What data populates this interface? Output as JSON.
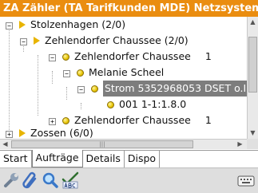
{
  "title": "ZA Zähler (TA Tarifkunden MDE) Netzsystem",
  "tree": {
    "items": [
      {
        "label": "Stolzenhagen (2/0)",
        "icon": "folder-triangle-icon",
        "expander": "−"
      },
      {
        "label": "Zehlendorfer Chaussee (2/0)",
        "icon": "folder-triangle-icon",
        "expander": "−"
      },
      {
        "label": "Zehlendorfer Chaussee",
        "suffix": "1",
        "icon": "address-dot-icon",
        "expander": "−"
      },
      {
        "label": "Melanie Scheel",
        "icon": "customer-dot-icon",
        "expander": "−"
      },
      {
        "label": "Strom 5352968053 DSET o.I",
        "icon": "meter-dot-icon",
        "expander": "−",
        "selected": true
      },
      {
        "label": "001 1-1:1.8.0",
        "icon": "register-dot-icon"
      },
      {
        "label": "Zehlendorfer Chaussee",
        "suffix": "1",
        "icon": "address-dot-icon",
        "expander": "+"
      },
      {
        "label": "Zossen (6/0)",
        "icon": "folder-triangle-icon",
        "expander": "+"
      }
    ]
  },
  "tabs": [
    {
      "label": "Start",
      "active": false
    },
    {
      "label": "Aufträge",
      "active": true
    },
    {
      "label": "Details",
      "active": false
    },
    {
      "label": "Dispo",
      "active": false
    }
  ],
  "toolbar": {
    "buttons": [
      "wrench-icon",
      "paperclip-icon",
      "magnifier-icon",
      "spellcheck-abc-icon"
    ],
    "keyboard": "keyboard-icon"
  },
  "colors": {
    "titlebar": "#ea8d10",
    "selection": "#7d7d7d",
    "folder": "#e8b400"
  }
}
